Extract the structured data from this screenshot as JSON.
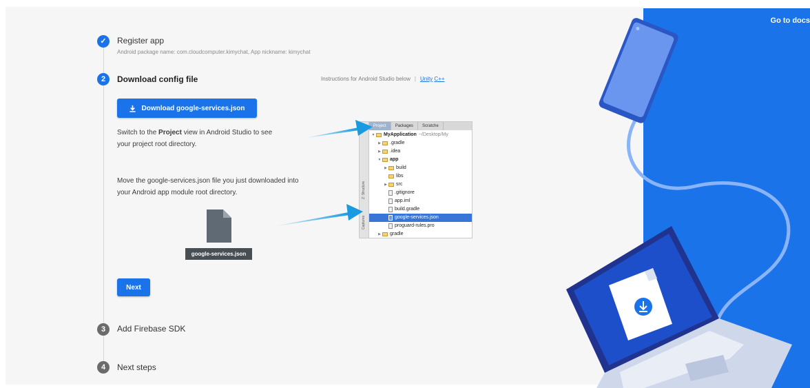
{
  "header": {
    "go_to_docs": "Go to docs"
  },
  "steps": [
    {
      "number": "✓",
      "title": "Register app",
      "subtitle": "Android package name: com.cloudcomputer.kimychat, App nickname: kimychat",
      "status": "done"
    },
    {
      "number": "2",
      "title": "Download config file",
      "status": "active"
    },
    {
      "number": "3",
      "title": "Add Firebase SDK",
      "status": "pending"
    },
    {
      "number": "4",
      "title": "Next steps",
      "status": "pending"
    }
  ],
  "instructions": {
    "text": "Instructions for Android Studio below",
    "separator": "|",
    "links": [
      "Unity",
      "C++"
    ]
  },
  "download_button": {
    "label": "Download google-services.json",
    "icon": "download-icon"
  },
  "paragraph1": {
    "before": "Switch to the ",
    "bold": "Project",
    "after_line1": " view in Android Studio to see",
    "line2": "your project root directory."
  },
  "paragraph2": {
    "line1": "Move the google-services.json file you just downloaded into",
    "line2": "your Android app module root directory."
  },
  "file_chip": "google-services.json",
  "next_button": "Next",
  "android_studio": {
    "tabs": [
      "Project",
      "Packages",
      "Scratche"
    ],
    "side_labels": [
      "Z: Structure",
      "Captures"
    ],
    "tree": [
      {
        "indent": 0,
        "arrow": "▼",
        "icon": "folder",
        "label": "MyApplication",
        "path": "~/Desktop/My",
        "bold": true
      },
      {
        "indent": 1,
        "arrow": "▶",
        "icon": "folder",
        "label": ".gradle"
      },
      {
        "indent": 1,
        "arrow": "▶",
        "icon": "folder",
        "label": ".idea"
      },
      {
        "indent": 1,
        "arrow": "▼",
        "icon": "folder",
        "label": "app",
        "bold": true
      },
      {
        "indent": 2,
        "arrow": "▶",
        "icon": "folder",
        "label": "build"
      },
      {
        "indent": 2,
        "arrow": "",
        "icon": "folder",
        "label": "libs"
      },
      {
        "indent": 2,
        "arrow": "▶",
        "icon": "folder",
        "label": "src"
      },
      {
        "indent": 2,
        "arrow": "",
        "icon": "file",
        "label": ".gitignore"
      },
      {
        "indent": 2,
        "arrow": "",
        "icon": "file",
        "label": "app.iml"
      },
      {
        "indent": 2,
        "arrow": "",
        "icon": "file",
        "label": "build.gradle"
      },
      {
        "indent": 2,
        "arrow": "",
        "icon": "file",
        "label": "google-services.json",
        "selected": true
      },
      {
        "indent": 2,
        "arrow": "",
        "icon": "file",
        "label": "proguard-rules.pro"
      },
      {
        "indent": 1,
        "arrow": "▶",
        "icon": "folder",
        "label": "gradle"
      }
    ]
  },
  "colors": {
    "accent": "#1a73e8",
    "panel_bg": "#1a73e8",
    "pending_step": "#6b6b6b",
    "content_bg": "#f6f6f6"
  }
}
